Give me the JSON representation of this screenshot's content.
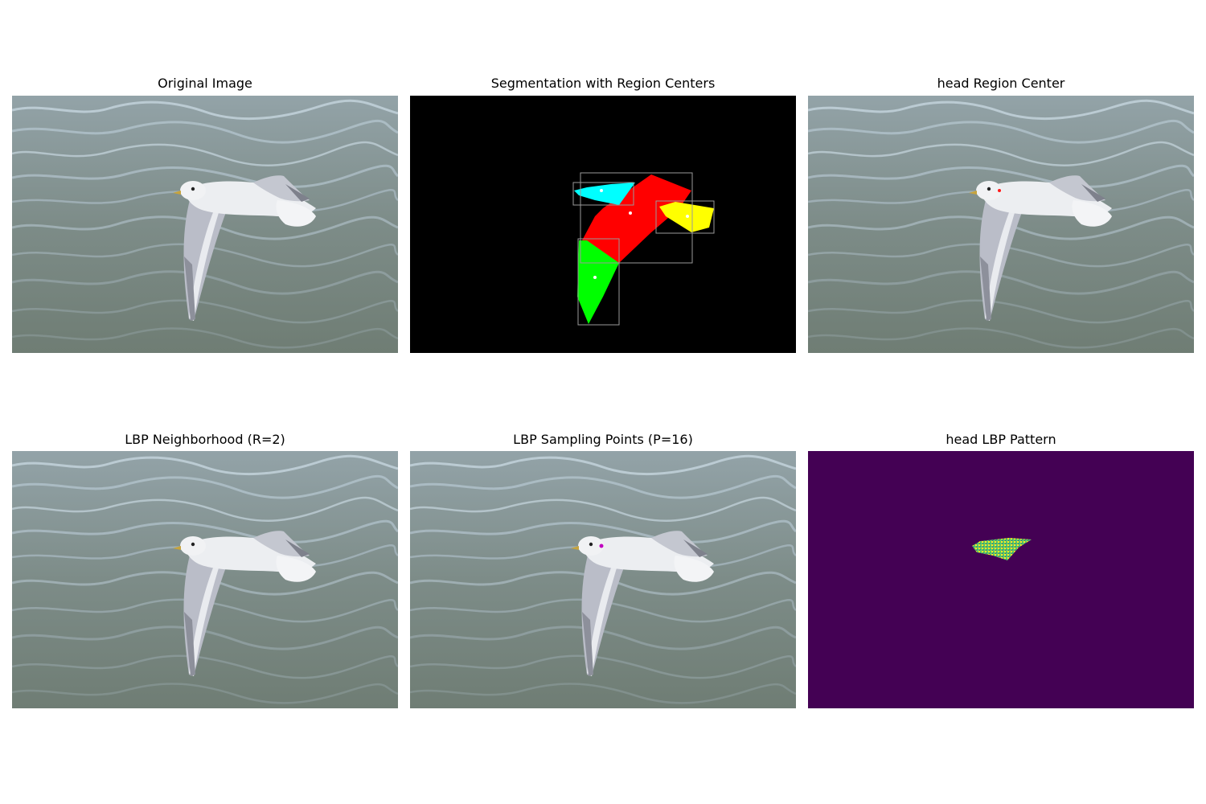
{
  "figure": {
    "panels": [
      {
        "id": "original",
        "title": "Original Image"
      },
      {
        "id": "segmentation",
        "title": "Segmentation with Region Centers"
      },
      {
        "id": "region-center",
        "title": "head Region Center"
      },
      {
        "id": "lbp-neighborhood",
        "title": "LBP Neighborhood (R=2)"
      },
      {
        "id": "lbp-sampling",
        "title": "LBP Sampling Points (P=16)"
      },
      {
        "id": "lbp-pattern",
        "title": "head LBP Pattern"
      }
    ]
  },
  "colors": {
    "water": "#7b8a86",
    "water_highlight": "#b9c9d2",
    "gull_body": "#eef0f2",
    "gull_wing": "#b9bcc7",
    "region_head": "#00ffff",
    "region_body": "#ff0000",
    "region_tail": "#ffff00",
    "region_wing": "#00ff00",
    "bbox": "#9a9a9a",
    "lbp_background": "#440154",
    "lbp_texture": "#8fd744",
    "center_marker": "#ff1a1a",
    "sample_marker": "#c000c0"
  }
}
